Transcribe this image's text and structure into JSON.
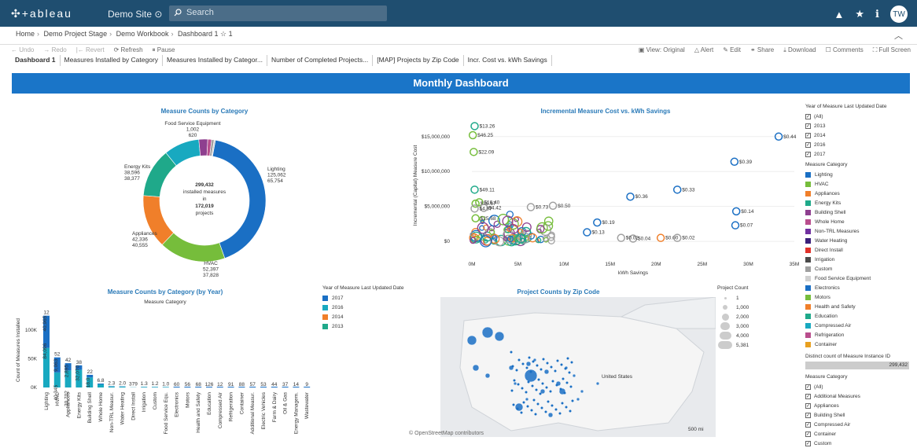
{
  "header": {
    "logo": "+ableau",
    "site": "Demo Site ⊙",
    "search_placeholder": "Search",
    "avatar": "TW"
  },
  "breadcrumb": [
    "Home",
    "Demo Project Stage",
    "Demo Workbook",
    "Dashboard 1"
  ],
  "breadcrumb_suffix": "☆ 1",
  "toolbar_left": [
    "Undo",
    "Redo",
    "Revert",
    "Refresh",
    "Pause"
  ],
  "toolbar_right": [
    "View: Original",
    "Alert",
    "Edit",
    "Share",
    "Download",
    "Comments",
    "Full Screen"
  ],
  "tabs": [
    "Dashboard 1",
    "Measures Installed by Category",
    "Measures Installed by Categor...",
    "Number of Completed Projects...",
    "[MAP] Projects by Zip Code",
    "Incr. Cost vs. kWh Savings"
  ],
  "banner": "Monthly Dashboard",
  "donut": {
    "title": "Measure Counts by Category",
    "center": [
      "299,432",
      "installed measures",
      "in",
      "172,019",
      "projects"
    ],
    "labels": [
      {
        "name": "Food Service Equipment",
        "v1": "1,002",
        "v2": "620"
      },
      {
        "name": "Lighting",
        "v1": "125,062",
        "v2": "65,754"
      },
      {
        "name": "Energy Kits",
        "v1": "38,596",
        "v2": "38,377"
      },
      {
        "name": "Appliances",
        "v1": "42,336",
        "v2": "40,555"
      },
      {
        "name": "HVAC",
        "v1": "52,397",
        "v2": "37,828"
      }
    ]
  },
  "chart_data": [
    {
      "type": "pie",
      "title": "Measure Counts by Category",
      "categories": [
        "Lighting",
        "HVAC",
        "Appliances",
        "Energy Kits",
        "Compressed Air",
        "Building Shell",
        "Whole Home",
        "Others",
        "Food Service Equipment"
      ],
      "values": [
        125062,
        52397,
        42336,
        38596,
        28000,
        7000,
        3000,
        2000,
        1002
      ],
      "colors": [
        "#1a6fc4",
        "#76bd3b",
        "#f07f2a",
        "#1fa98a",
        "#18a9c0",
        "#8e3f8f",
        "#b94e8d",
        "#a0a0a0",
        "#d0d0d0"
      ]
    },
    {
      "type": "scatter",
      "title": "Incremental Measure Cost vs. kWh Savings",
      "xlabel": "kWh Savings",
      "ylabel": "Incremental (Capital) Measure Cost",
      "xlim": [
        0,
        35
      ],
      "ylim": [
        -1,
        17
      ],
      "x_ticks": [
        "0M",
        "5M",
        "10M",
        "15M",
        "20M",
        "25M",
        "30M",
        "35M"
      ],
      "y_ticks": [
        "$0",
        "$5,000,000",
        "$10,000,000",
        "$15,000,000"
      ],
      "labeled_points": [
        {
          "x": 0.3,
          "y": 16.5,
          "label": "$13.26",
          "color": "#1fa98a"
        },
        {
          "x": 0.1,
          "y": 15.2,
          "label": "$46.25",
          "color": "#76bd3b"
        },
        {
          "x": 0.2,
          "y": 12.8,
          "label": "$22.09",
          "color": "#76bd3b"
        },
        {
          "x": 0.3,
          "y": 7.4,
          "label": "$49.11",
          "color": "#1fa98a"
        },
        {
          "x": 0.8,
          "y": 5.6,
          "label": "$16.40",
          "color": "#76bd3b"
        },
        {
          "x": 0.4,
          "y": 5.4,
          "label": "$16.67",
          "color": "#76bd3b"
        },
        {
          "x": 1.3,
          "y": 4.8,
          "label": "$4.42",
          "color": "#a0a0a0"
        },
        {
          "x": 0.3,
          "y": 4.7,
          "label": "$4.97",
          "color": "#a0a0a0"
        },
        {
          "x": 0.4,
          "y": 3.3,
          "label": "$25.68",
          "color": "#76bd3b"
        },
        {
          "x": 6.4,
          "y": 4.9,
          "label": "$0.73",
          "color": "#a0a0a0"
        },
        {
          "x": 8.8,
          "y": 5.1,
          "label": "$0.50",
          "color": "#a0a0a0"
        },
        {
          "x": 17.2,
          "y": 6.4,
          "label": "$0.36",
          "color": "#1a6fc4"
        },
        {
          "x": 22.3,
          "y": 7.4,
          "label": "$0.33",
          "color": "#1a6fc4"
        },
        {
          "x": 28.5,
          "y": 11.4,
          "label": "$0.39",
          "color": "#1a6fc4"
        },
        {
          "x": 33.3,
          "y": 15.0,
          "label": "$0.44",
          "color": "#1a6fc4"
        },
        {
          "x": 28.7,
          "y": 4.3,
          "label": "$0.14",
          "color": "#1a6fc4"
        },
        {
          "x": 28.6,
          "y": 2.3,
          "label": "$0.07",
          "color": "#1a6fc4"
        },
        {
          "x": 13.6,
          "y": 2.7,
          "label": "$0.19",
          "color": "#1a6fc4"
        },
        {
          "x": 12.5,
          "y": 1.3,
          "label": "$0.13",
          "color": "#1a6fc4"
        },
        {
          "x": 17.5,
          "y": 0.4,
          "label": "$0.04",
          "color": "#a0a0a0"
        },
        {
          "x": 16.2,
          "y": 0.5,
          "label": "$0.02",
          "color": "#a0a0a0"
        },
        {
          "x": 20.5,
          "y": 0.5,
          "label": "$0.00",
          "color": "#f07f2a"
        },
        {
          "x": 22.3,
          "y": 0.5,
          "label": "$0.02",
          "color": "#a0a0a0"
        }
      ]
    },
    {
      "type": "bar",
      "title": "Measure Counts by Category (by Year)",
      "subtitle": "Measure Category",
      "ylabel": "Count of Measures Installed",
      "y_ticks": [
        "0K",
        "50K",
        "100K"
      ],
      "ylim": [
        0,
        130
      ],
      "categories": [
        "Lighting",
        "HVAC",
        "Appliances",
        "Energy Kits",
        "Building Shell",
        "Whole Home",
        "Non-TRL Measur.",
        "Water Heating",
        "Direct Install",
        "Irrigation",
        "Custom",
        "Food Service Equ.",
        "Electronics",
        "Motors",
        "Health and Safety",
        "Education",
        "Compressed Air",
        "Refrigeration",
        "Container",
        "Additional Measur.",
        "Electric Vehicles",
        "Farm & Dairy",
        "Oil & Gas",
        "Energy Managem.",
        "Wastewater"
      ],
      "top_labels": [
        "12",
        "52",
        "42",
        "38",
        "22",
        "6.8",
        "2.3",
        "2.0",
        "379",
        "1.3",
        "1.2",
        "1.0",
        "60",
        "56",
        "68",
        "126",
        "12",
        "91",
        "88",
        "57",
        "53",
        "44",
        "37",
        "14",
        "9"
      ],
      "values": [
        125.0,
        52.4,
        42.3,
        38.6,
        22.0,
        6.8,
        2.3,
        2.0,
        0.4,
        1.3,
        1.2,
        1.0,
        0.1,
        0.1,
        0.1,
        0.1,
        0.0,
        0.1,
        0.1,
        0.1,
        0.1,
        0.0,
        0.0,
        0.0,
        0.0
      ],
      "series": [
        {
          "name": "2017",
          "color": "#1a6fc4"
        },
        {
          "name": "2016",
          "color": "#18a9c0"
        },
        {
          "name": "2014",
          "color": "#f07f2a"
        },
        {
          "name": "2013",
          "color": "#1fa98a"
        }
      ],
      "segment_labels": [
        [
          "40,965",
          "84,096"
        ],
        [
          "9,063",
          "40,345"
        ],
        [
          "2,895",
          "30,702"
        ],
        [
          "32,070"
        ],
        [
          "18,0"
        ]
      ]
    },
    {
      "type": "map",
      "title": "Project Counts by Zip Code",
      "labels": [
        "United States",
        "500 mi"
      ]
    }
  ],
  "year_legend": {
    "title": "Year of Measure Last Updated Date",
    "items": [
      {
        "label": "2017",
        "color": "#1a6fc4"
      },
      {
        "label": "2016",
        "color": "#18a9c0"
      },
      {
        "label": "2014",
        "color": "#f07f2a"
      },
      {
        "label": "2013",
        "color": "#1fa98a"
      }
    ]
  },
  "project_count_legend": {
    "title": "Project Count",
    "items": [
      "1",
      "1,000",
      "2,000",
      "3,000",
      "4,000",
      "5,381"
    ]
  },
  "right_panel": {
    "year_filter_title": "Year of Measure Last Updated Date",
    "year_filter": [
      "(All)",
      "2013",
      "2014",
      "2016",
      "2017"
    ],
    "category_legend_title": "Measure Category",
    "category_legend": [
      {
        "label": "Lighting",
        "color": "#1a6fc4"
      },
      {
        "label": "HVAC",
        "color": "#76bd3b"
      },
      {
        "label": "Appliances",
        "color": "#f07f2a"
      },
      {
        "label": "Energy Kits",
        "color": "#1fa98a"
      },
      {
        "label": "Building Shell",
        "color": "#8e3f8f"
      },
      {
        "label": "Whole Home",
        "color": "#b94e8d"
      },
      {
        "label": "Non-TRL Measures",
        "color": "#7030a0"
      },
      {
        "label": "Water Heating",
        "color": "#3a1f7a"
      },
      {
        "label": "Direct Install",
        "color": "#e0322a"
      },
      {
        "label": "Irrigation",
        "color": "#4a4a4a"
      },
      {
        "label": "Custom",
        "color": "#a0a0a0"
      },
      {
        "label": "Food Service Equipment",
        "color": "#d0d0d0"
      },
      {
        "label": "Electronics",
        "color": "#1a6fc4"
      },
      {
        "label": "Motors",
        "color": "#76bd3b"
      },
      {
        "label": "Health and Safety",
        "color": "#f07f2a"
      },
      {
        "label": "Education",
        "color": "#1fa98a"
      },
      {
        "label": "Compressed Air",
        "color": "#18a9c0"
      },
      {
        "label": "Refrigeration",
        "color": "#b94e8d"
      },
      {
        "label": "Container",
        "color": "#e8a020"
      }
    ],
    "distinct_title": "Distinct count of Measure Instance ID",
    "distinct_value": "299,432",
    "cat_filter_title": "Measure Category",
    "cat_filter": [
      "(All)",
      "Additional Measures",
      "Appliances",
      "Building Shell",
      "Compressed Air",
      "Container",
      "Custom"
    ]
  },
  "attribution": "© OpenStreetMap contributors"
}
